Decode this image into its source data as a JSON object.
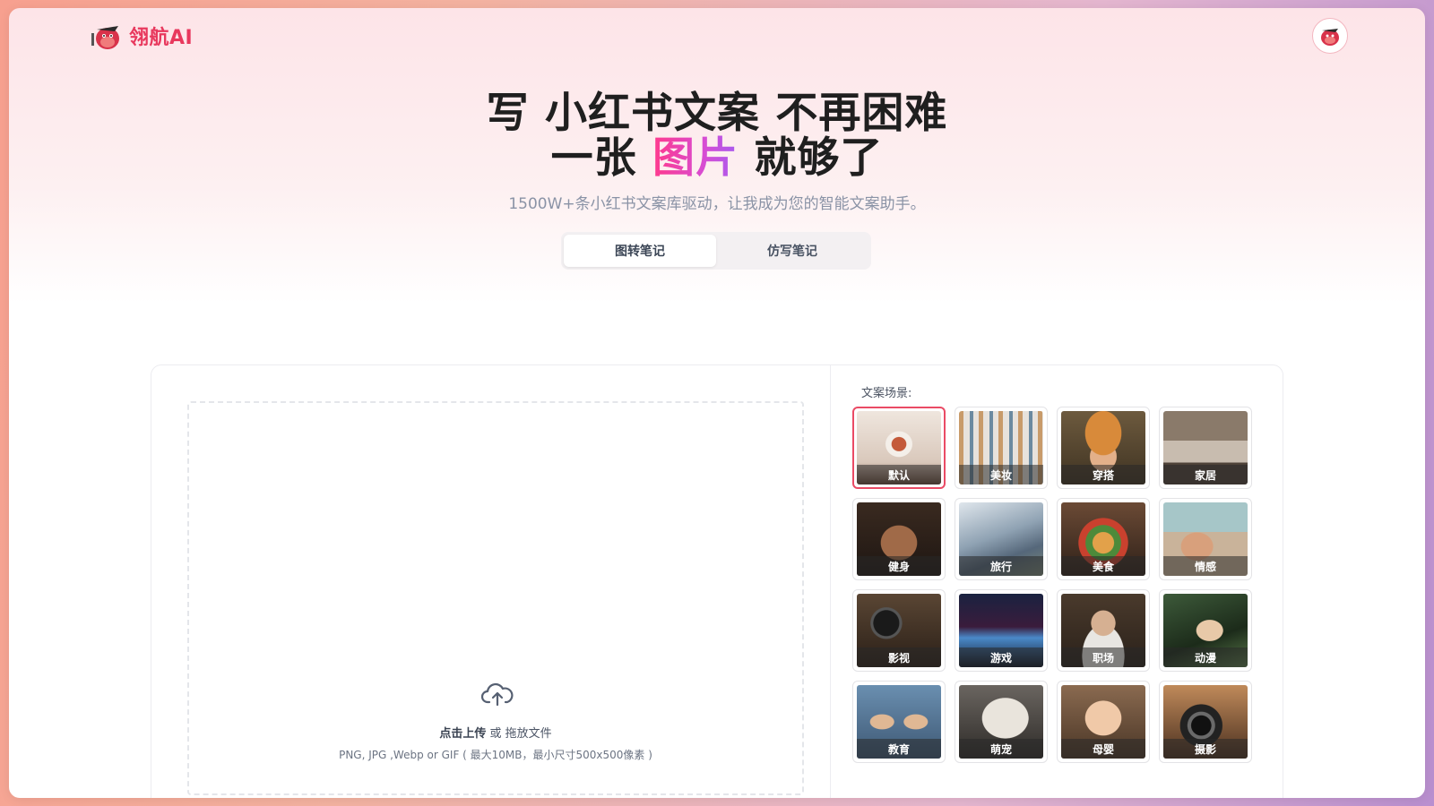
{
  "brand": {
    "name": "翎航AI",
    "accent": "#e8385d"
  },
  "hero": {
    "line1": "写 小红书文案 不再困难",
    "line2_prefix": "一张 ",
    "line2_highlight": "图片",
    "line2_suffix": " 就够了",
    "subtitle": "1500W+条小红书文案库驱动，让我成为您的智能文案助手。"
  },
  "tabs": [
    {
      "label": "图转笔记",
      "active": true
    },
    {
      "label": "仿写笔记",
      "active": false
    }
  ],
  "upload": {
    "action": "点击上传",
    "or_drag": " 或 拖放文件",
    "hint": "PNG, JPG ,Webp or GIF ( 最大10MB，最小尺寸500x500像素 )"
  },
  "scenes": {
    "label": "文案场景:",
    "items": [
      {
        "label": "默认",
        "selected": true
      },
      {
        "label": "美妆",
        "selected": false
      },
      {
        "label": "穿搭",
        "selected": false
      },
      {
        "label": "家居",
        "selected": false
      },
      {
        "label": "健身",
        "selected": false
      },
      {
        "label": "旅行",
        "selected": false
      },
      {
        "label": "美食",
        "selected": false
      },
      {
        "label": "情感",
        "selected": false
      },
      {
        "label": "影视",
        "selected": false
      },
      {
        "label": "游戏",
        "selected": false
      },
      {
        "label": "职场",
        "selected": false
      },
      {
        "label": "动漫",
        "selected": false
      },
      {
        "label": "教育",
        "selected": false
      },
      {
        "label": "萌宠",
        "selected": false
      },
      {
        "label": "母婴",
        "selected": false
      },
      {
        "label": "摄影",
        "selected": false
      }
    ]
  }
}
